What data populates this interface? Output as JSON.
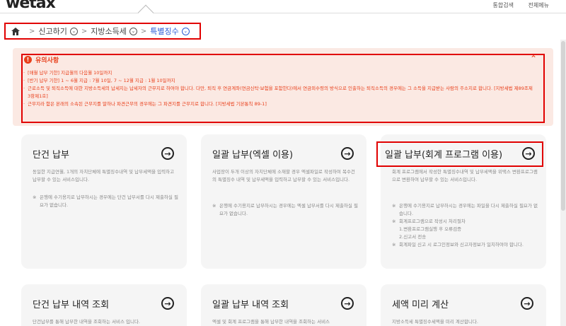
{
  "header": {
    "logo": "wetax",
    "links": [
      "통합검색",
      "전체메뉴"
    ]
  },
  "breadcrumb": {
    "items": [
      "신고하기",
      "지방소득세",
      "특별징수"
    ]
  },
  "notice": {
    "title": "유의사항",
    "items": [
      "[매월 납부 기한] 지급월의 다음월 10일까지",
      "[반기 납부 기한] 1 ~ 6월 지급 : 7월 10일, 7 ~ 12월 지급 : 1월 10일까지",
      "근로소득 및 퇴직소득에 대한 지방소득세의 납세지는 납세자의 근무지로 하여야 합니다. 다만, 퇴직 후 연금계좌(연금신탁·보험을 포함한다)에서 연금외수령의 방식으로 인출하는 퇴직소득의 경우에는 그 소득을 지급받는 사람의 주소지로 합니다. [지방세법 제89조제3항제1호]",
      "근무지라 함은 본래의 소속된 근무지를 말하나 파견근무의 경우에는 그 파견지를 근무지로 합니다. [지방세법 기본통칙 89-1]"
    ]
  },
  "cards": [
    {
      "title": "단건 납부",
      "desc": "동일한 지급연월, 1개의 자치단체에 특별징수내역 및 납부세액을 입력하고 납부할 수 있는 서비스입니다.",
      "notes": [
        "은행에 수기용지로 납부하시는 경우에는 단건 납부서를 다시 제출하실 필요가 없습니다."
      ]
    },
    {
      "title": "일괄 납부(엑셀 이용)",
      "desc": "사업장이 두개 이상의 자치단체에 소재할 경우 엑셀파일로 작성하여 복수건의 특별징수 내역 및 납부세액을 입력하고 납부할 수 있는 서비스입니다.",
      "notes": [
        "은행에 수기용지로 납부하시는 경우에는 엑셀 납부서를 다시 제출하실 필요가 없습니다."
      ]
    },
    {
      "title": "일괄 납부(회계 프로그램 이용)",
      "desc": "회계 프로그램에서 작성한 특별징수내역 및 납부세액을 위택스 변환프로그램으로 변환하여 납부할 수 있는 서비스입니다.",
      "notes": [
        "은행에 수기용지로 납부하시는 경우에는 파일을 다시 제출하실 필요가 없습니다.",
        "회계프로그램으로 작성시 처리절차"
      ],
      "steps": [
        "1.변환프로그램실행 후 오류검증",
        "2.신고서 전송"
      ],
      "notes2": [
        "회계파일 신고 시 로그인정보와 신고자정보가 일치하여야 합니다."
      ]
    },
    {
      "title": "단건 납부 내역 조회",
      "desc": "단건납부를 통해 납부한 내역을 조회하는 서비스 입니다."
    },
    {
      "title": "일괄 납부 내역 조회",
      "desc": "엑셀 및 회계 프로그램을 통해 납부한 내역을 조회하는 서비스"
    },
    {
      "title": "세액 미리 계산",
      "desc": "지방소득세 특별징수세액을 미리 계산합니다."
    }
  ],
  "colors": {
    "accent": "#e8401c",
    "link": "#2a5bd7",
    "highlight_box": "#e10000",
    "notice_bg": "#fbe9e3",
    "card_bg": "#f5f5f5"
  },
  "icons": [
    "home-icon",
    "chevron-down-icon",
    "alert-icon",
    "arrow-right-circle-icon"
  ]
}
